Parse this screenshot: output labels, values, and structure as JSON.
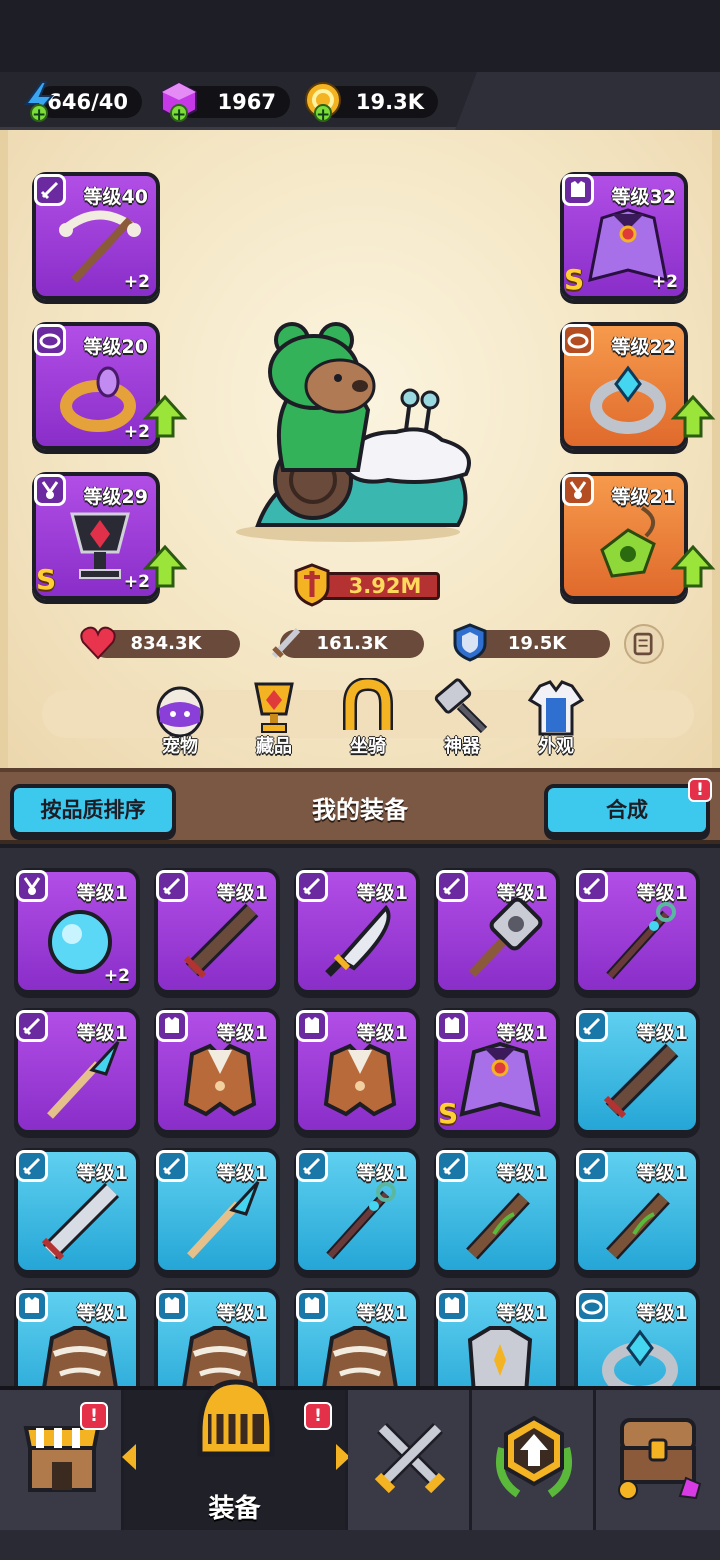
{
  "resources": {
    "energy": "646/40",
    "gems": "1967",
    "coins": "19.3K"
  },
  "equipped": {
    "weapon": {
      "level": "等级40",
      "bonus": "+2"
    },
    "ring": {
      "level": "等级20",
      "bonus": "+2"
    },
    "amulet": {
      "level": "等级29",
      "bonus": "+2",
      "tier": "S"
    },
    "armor": {
      "level": "等级32",
      "bonus": "+2",
      "tier": "S"
    },
    "bracelet": {
      "level": "等级22"
    },
    "necklace": {
      "level": "等级21"
    }
  },
  "combat_power": "3.92M",
  "stats": {
    "hp": "834.3K",
    "attack": "161.3K",
    "defense": "19.5K"
  },
  "menu": {
    "pet": "宠物",
    "collection": "藏品",
    "mount": "坐骑",
    "artifact": "神器",
    "appearance": "外观"
  },
  "panel": {
    "sort_button": "按品质排序",
    "title": "我的装备",
    "merge_button": "合成",
    "merge_badge": "!"
  },
  "inventory": [
    {
      "level": "等级1",
      "rarity": "purple",
      "item": "orb",
      "bonus": "+2"
    },
    {
      "level": "等级1",
      "rarity": "purple",
      "item": "dark-sword"
    },
    {
      "level": "等级1",
      "rarity": "purple",
      "item": "machete"
    },
    {
      "level": "等级1",
      "rarity": "purple",
      "item": "mace"
    },
    {
      "level": "等级1",
      "rarity": "purple",
      "item": "staff"
    },
    {
      "level": "等级1",
      "rarity": "purple",
      "item": "ice-spear"
    },
    {
      "level": "等级1",
      "rarity": "purple",
      "item": "leather-armor"
    },
    {
      "level": "等级1",
      "rarity": "purple",
      "item": "leather-armor"
    },
    {
      "level": "等级1",
      "rarity": "purple",
      "item": "cape",
      "tier": "S"
    },
    {
      "level": "等级1",
      "rarity": "blue",
      "item": "dark-sword"
    },
    {
      "level": "等级1",
      "rarity": "blue",
      "item": "broadsword"
    },
    {
      "level": "等级1",
      "rarity": "blue",
      "item": "ice-spear"
    },
    {
      "level": "等级1",
      "rarity": "blue",
      "item": "staff"
    },
    {
      "level": "等级1",
      "rarity": "blue",
      "item": "club"
    },
    {
      "level": "等级1",
      "rarity": "blue",
      "item": "club"
    },
    {
      "level": "等级1",
      "rarity": "blue",
      "item": "fur-armor"
    },
    {
      "level": "等级1",
      "rarity": "blue",
      "item": "fur-armor"
    },
    {
      "level": "等级1",
      "rarity": "blue",
      "item": "fur-armor"
    },
    {
      "level": "等级1",
      "rarity": "blue",
      "item": "plate-armor"
    },
    {
      "level": "等级1",
      "rarity": "blue",
      "item": "bracelet"
    }
  ],
  "nav": {
    "equipment": "装备",
    "shop_badge": "!",
    "equipment_badge": "!"
  },
  "colors": {
    "purple": "#9b3fd8",
    "blue": "#3bbbe6",
    "orange": "#ec7a36",
    "power": "#b43232"
  }
}
